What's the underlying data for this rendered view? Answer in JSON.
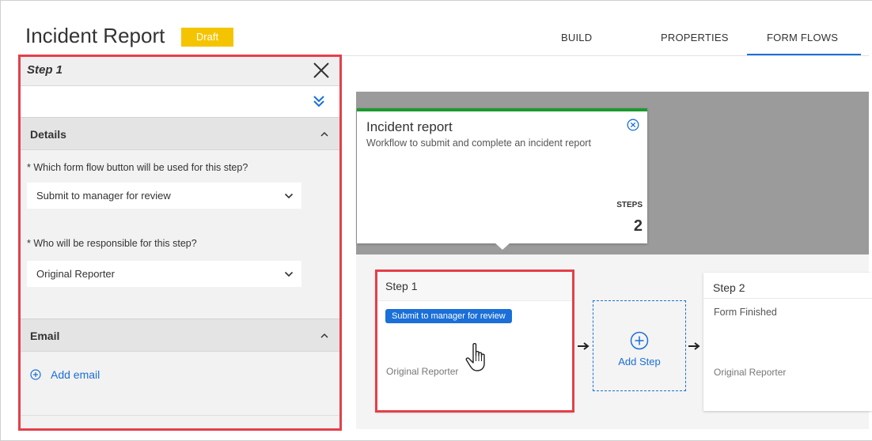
{
  "header": {
    "title": "Incident Report",
    "badge": "Draft",
    "tabs": [
      {
        "label": "BUILD",
        "active": false
      },
      {
        "label": "PROPERTIES",
        "active": false
      },
      {
        "label": "FORM FLOWS",
        "active": true
      }
    ]
  },
  "panel": {
    "title": "Step 1",
    "details": {
      "heading": "Details",
      "question_button": "* Which form flow button will be used for this step?",
      "selected_button": "Submit to manager for review",
      "question_responsible": "* Who will be responsible for this step?",
      "selected_responsible": "Original Reporter"
    },
    "email": {
      "heading": "Email",
      "add_label": "Add email"
    }
  },
  "flow": {
    "name": "Incident report",
    "description": "Workflow to submit and complete an incident report",
    "steps_label": "STEPS",
    "steps_count": "2"
  },
  "steps": [
    {
      "title": "Step 1",
      "button": "Submit to manager for review",
      "owner": "Original Reporter"
    },
    {
      "title": "Step 2",
      "subtitle": "Form Finished",
      "owner": "Original Reporter"
    }
  ],
  "add_step": {
    "label": "Add Step"
  },
  "colors": {
    "accent": "#1a6fd8",
    "badge": "#f5c400",
    "highlight": "#e3404a",
    "flow_top": "#1c9a30"
  }
}
